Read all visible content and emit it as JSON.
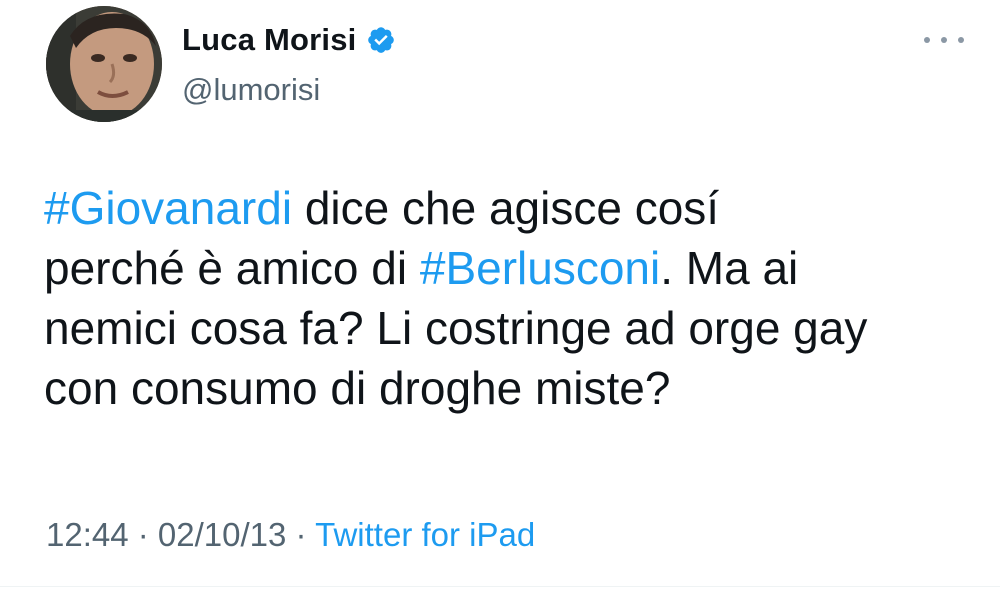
{
  "user": {
    "display_name": "Luca Morisi",
    "handle": "@lumorisi",
    "verified": true
  },
  "tweet": {
    "line1": {
      "hashtag": "#Giovanardi",
      "text": " dice che agisce cosí"
    },
    "line2": {
      "before": "perché è amico di ",
      "hashtag": "#Berlusconi",
      "after": ". Ma ai"
    },
    "line3": "nemici cosa fa? Li costringe ad orge gay",
    "line4": "con consumo di droghe miste?"
  },
  "meta": {
    "time": "12:44",
    "sep1": " · ",
    "date": "02/10/13",
    "sep2": " · ",
    "source": "Twitter for iPad"
  },
  "colors": {
    "link": "#1d9bf0",
    "secondary": "#536471",
    "text": "#0f1419",
    "verified": "#1d9bf0"
  },
  "icons": {
    "verified": "verified-badge-icon",
    "more": "more-dots-icon"
  }
}
